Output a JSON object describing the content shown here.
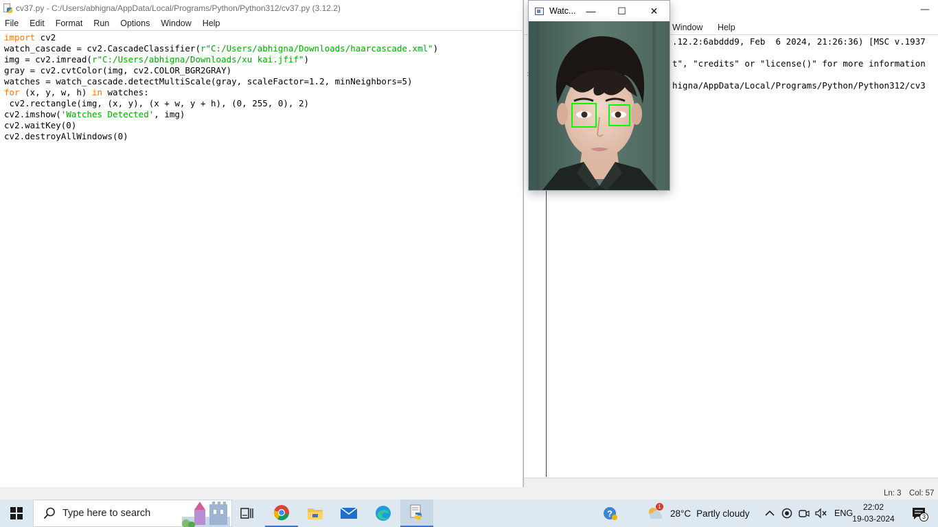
{
  "editor": {
    "title": "cv37.py - C:/Users/abhigna/AppData/Local/Programs/Python/Python312/cv37.py (3.12.2)",
    "menu": [
      "File",
      "Edit",
      "Format",
      "Run",
      "Options",
      "Window",
      "Help"
    ],
    "code_lines": [
      [
        {
          "t": "import",
          "c": "kw"
        },
        {
          "t": " cv2",
          "c": ""
        }
      ],
      [
        {
          "t": "watch_cascade = cv2.CascadeClassifier(",
          "c": ""
        },
        {
          "t": "r\"C:/Users/abhigna/Downloads/haarcascade.xml\"",
          "c": "str"
        },
        {
          "t": ")",
          "c": ""
        }
      ],
      [
        {
          "t": "img = cv2.imread(",
          "c": ""
        },
        {
          "t": "r\"C:/Users/abhigna/Downloads/xu kai.jfif\"",
          "c": "str"
        },
        {
          "t": ")",
          "c": ""
        }
      ],
      [
        {
          "t": "gray = cv2.cvtColor(img, cv2.COLOR_BGR2GRAY)",
          "c": ""
        }
      ],
      [
        {
          "t": "watches = watch_cascade.detectMultiScale(gray, scaleFactor=1.2, minNeighbors=5)",
          "c": ""
        }
      ],
      [
        {
          "t": "for",
          "c": "kw"
        },
        {
          "t": " (x, y, w, h) ",
          "c": ""
        },
        {
          "t": "in",
          "c": "kw"
        },
        {
          "t": " watches:",
          "c": ""
        }
      ],
      [
        {
          "t": " cv2.rectangle(img, (x, y), (x + w, y + h), (0, 255, 0), 2)",
          "c": ""
        }
      ],
      [
        {
          "t": "cv2.imshow(",
          "c": ""
        },
        {
          "t": "'Watches Detected'",
          "c": "str"
        },
        {
          "t": ", img)",
          "c": ""
        }
      ],
      [
        {
          "t": "cv2.waitKey(0)",
          "c": ""
        }
      ],
      [
        {
          "t": "cv2.destroyAllWindows(0)",
          "c": ""
        }
      ]
    ]
  },
  "shell": {
    "menu": [
      "Window",
      "Help"
    ],
    "lines": [
      ".12.2:6abddd9, Feb  6 2024, 21:26:36) [MSC v.1937",
      "",
      "t\", \"credits\" or \"license()\" for more information",
      "",
      "higna/AppData/Local/Programs/Python/Python312/cv3"
    ],
    "gutter_mark": ">",
    "minimize_glyph": "—"
  },
  "image_window": {
    "title": "Watc...",
    "min_glyph": "—",
    "max_glyph": "☐",
    "close_glyph": "✕"
  },
  "status": {
    "ln": "Ln: 3",
    "col": "Col: 57"
  },
  "taskbar": {
    "search_placeholder": "Type here to search",
    "weather_temp": "28°C",
    "weather_desc": "Partly cloudy",
    "weather_badge": "1",
    "lang": "ENG",
    "time": "22:02",
    "date": "19-03-2024",
    "notif_count": "3",
    "apps": [
      "task-view",
      "chrome",
      "file-explorer",
      "mail",
      "edge",
      "python-idle"
    ]
  },
  "colors": {
    "keyword": "#ff7700",
    "string": "#00aa00",
    "detection_box": "#00ff00",
    "taskbar_bg": "#dde8f1"
  }
}
